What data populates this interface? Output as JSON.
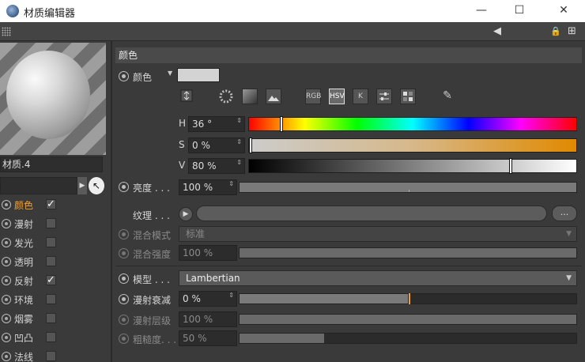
{
  "window": {
    "title": "材质编辑器",
    "min_label": "—",
    "max_label": "☐",
    "close_label": "✕"
  },
  "toolbar": {
    "nav_back_icon": "◀",
    "lock_icon": "🔒",
    "new_icon": "⊞"
  },
  "material": {
    "name": "材质.4",
    "combo_arrow": "▶",
    "pick_icon": "↖"
  },
  "channels": [
    {
      "label": "颜色",
      "checked": true,
      "check_mark": "✓",
      "active": true
    },
    {
      "label": "漫射",
      "checked": false,
      "check_mark": ""
    },
    {
      "label": "发光",
      "checked": false,
      "check_mark": ""
    },
    {
      "label": "透明",
      "checked": false,
      "check_mark": ""
    },
    {
      "label": "反射",
      "checked": true,
      "check_mark": "✓"
    },
    {
      "label": "环境",
      "checked": false,
      "check_mark": ""
    },
    {
      "label": "烟雾",
      "checked": false,
      "check_mark": ""
    },
    {
      "label": "凹凸",
      "checked": false,
      "check_mark": ""
    },
    {
      "label": "法线",
      "checked": false,
      "check_mark": ""
    }
  ],
  "section": {
    "title": "颜色"
  },
  "color": {
    "label": "颜色",
    "drop_icon": "▼",
    "swatch_color": "#d3d3d3",
    "modes": {
      "rgb": "RGB",
      "hsv": "HSV",
      "k": "K"
    },
    "picker_icon": "✎"
  },
  "hsv": {
    "h": {
      "label": "H",
      "value": "36 °",
      "position": 0.1
    },
    "s": {
      "label": "S",
      "value": "0 %",
      "position": 0.0
    },
    "v": {
      "label": "V",
      "value": "80 %",
      "position": 0.8
    },
    "spin": "⇕"
  },
  "brightness": {
    "label": "亮度 . . .",
    "value": "100 %",
    "level": 1.0
  },
  "texture": {
    "label": "纹理 . . .",
    "play_icon": "▶",
    "more_label": "..."
  },
  "blend_mode": {
    "label": "混合模式",
    "value": "标准",
    "arrow": "▼"
  },
  "blend_strength": {
    "label": "混合强度",
    "value": "100 %",
    "level": 1.0
  },
  "model": {
    "label": "模型 . . .",
    "value": "Lambertian",
    "arrow": "▼"
  },
  "diffuse_falloff": {
    "label": "漫射衰减",
    "value": "0 %",
    "level": 0.5
  },
  "diffuse_level": {
    "label": "漫射层级",
    "value": "100 %",
    "level": 1.0
  },
  "roughness": {
    "label": "粗糙度. . .",
    "value": "50 %",
    "level": 0.25
  }
}
